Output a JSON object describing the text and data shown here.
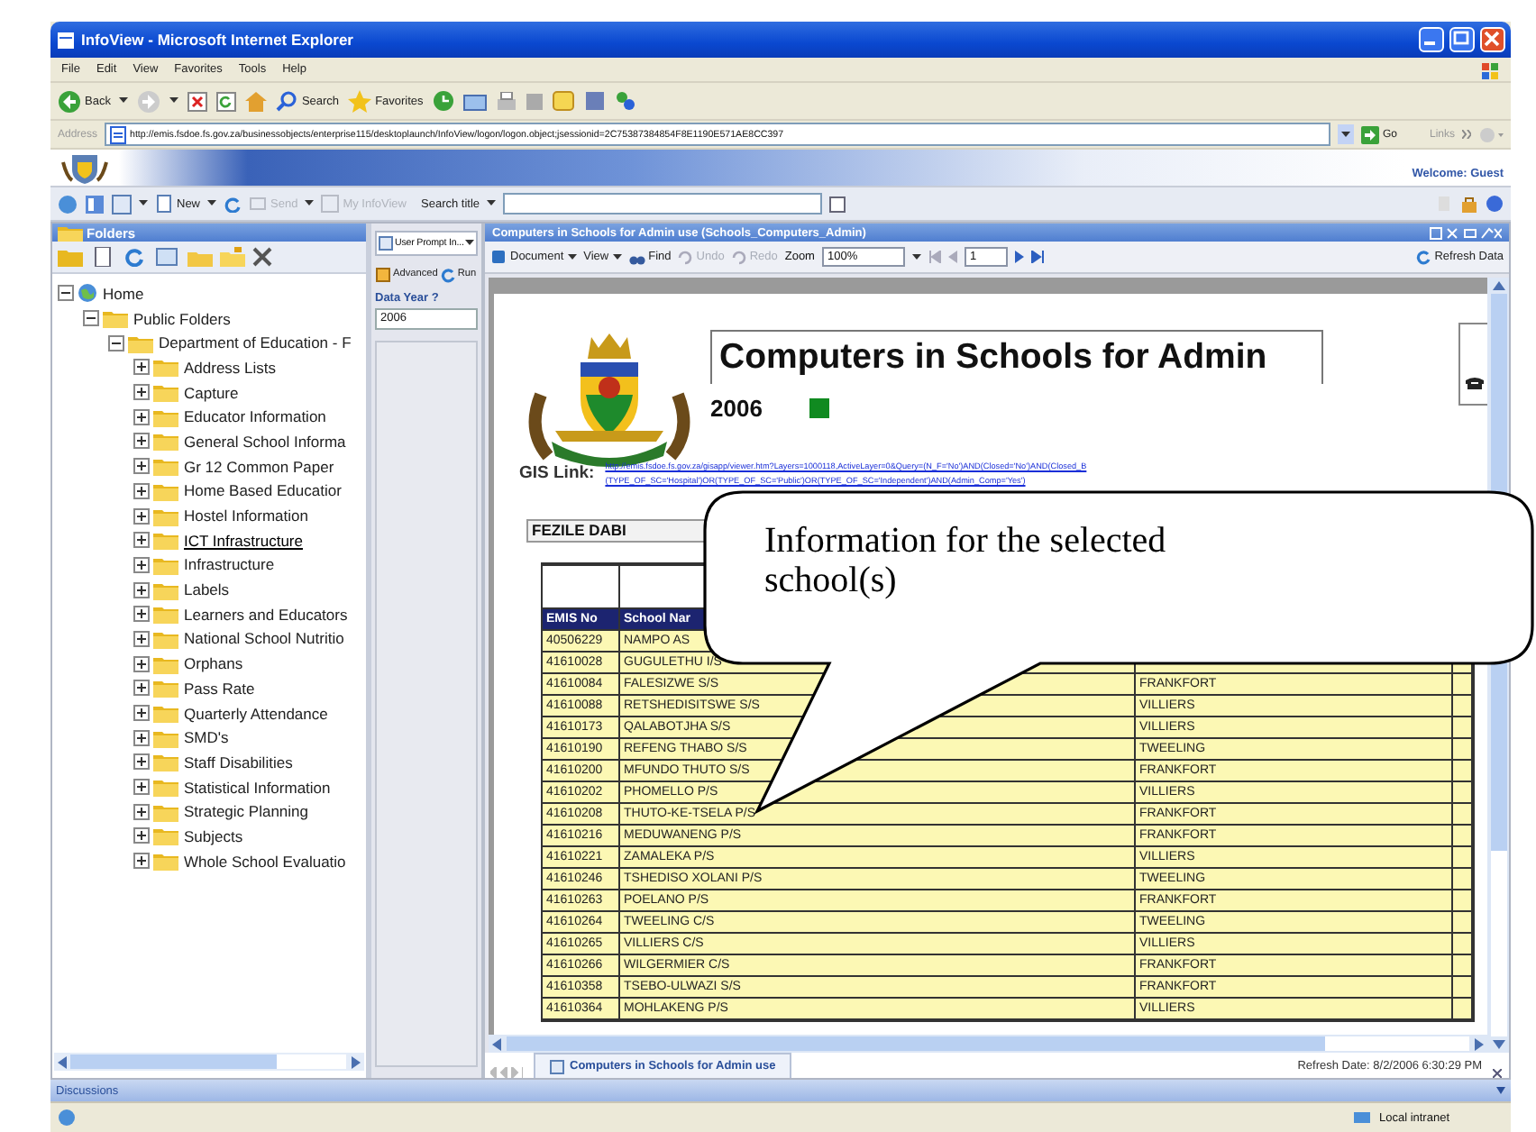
{
  "window": {
    "title": "InfoView - Microsoft Internet Explorer"
  },
  "menu": [
    "File",
    "Edit",
    "View",
    "Favorites",
    "Tools",
    "Help"
  ],
  "toolbar": [
    {
      "label": "Back",
      "kind": "back"
    },
    {
      "label": "Search",
      "kind": "search"
    },
    {
      "label": "Favorites",
      "kind": "favorites"
    }
  ],
  "address": {
    "label": "Address",
    "value": "http://emis.fsdoe.fs.gov.za/businessobjects/enterprise115/desktoplaunch/InfoView/logon/logon.object;jsessionid=2C75387384854F8E1190E571AE8CC397",
    "go": "Go",
    "links": "Links"
  },
  "infoview": {
    "welcome": "Welcome: Guest",
    "toolbar": [
      {
        "label": "New",
        "disabled": false
      },
      {
        "label": "Send",
        "disabled": true
      },
      {
        "label": "My InfoView",
        "disabled": true
      }
    ],
    "search_label": "Search title"
  },
  "folders": {
    "title": "Folders",
    "tree": [
      {
        "label": "Home",
        "expanded": true,
        "selected": false,
        "children": [
          {
            "label": "Public Folders",
            "expanded": true,
            "selected": false,
            "children": [
              {
                "label": "Department of Education - F",
                "expanded": true,
                "selected": false,
                "children": [
                  {
                    "label": "Address Lists",
                    "expanded": false,
                    "selected": false
                  },
                  {
                    "label": "Capture",
                    "expanded": false,
                    "selected": false
                  },
                  {
                    "label": "Educator Information",
                    "expanded": false,
                    "selected": false
                  },
                  {
                    "label": "General School Informa",
                    "expanded": false,
                    "selected": false
                  },
                  {
                    "label": "Gr 12 Common Paper",
                    "expanded": false,
                    "selected": false
                  },
                  {
                    "label": "Home Based Educatior",
                    "expanded": false,
                    "selected": false
                  },
                  {
                    "label": "Hostel Information",
                    "expanded": false,
                    "selected": false
                  },
                  {
                    "label": "ICT Infrastructure",
                    "expanded": false,
                    "selected": true
                  },
                  {
                    "label": "Infrastructure",
                    "expanded": false,
                    "selected": false
                  },
                  {
                    "label": "Labels",
                    "expanded": false,
                    "selected": false
                  },
                  {
                    "label": "Learners and Educators",
                    "expanded": false,
                    "selected": false
                  },
                  {
                    "label": "National School Nutritio",
                    "expanded": false,
                    "selected": false
                  },
                  {
                    "label": "Orphans",
                    "expanded": false,
                    "selected": false
                  },
                  {
                    "label": "Pass Rate",
                    "expanded": false,
                    "selected": false
                  },
                  {
                    "label": "Quarterly Attendance",
                    "expanded": false,
                    "selected": false
                  },
                  {
                    "label": "SMD's",
                    "expanded": false,
                    "selected": false
                  },
                  {
                    "label": "Staff Disabilities",
                    "expanded": false,
                    "selected": false
                  },
                  {
                    "label": "Statistical Information",
                    "expanded": false,
                    "selected": false
                  },
                  {
                    "label": "Strategic Planning",
                    "expanded": false,
                    "selected": false
                  },
                  {
                    "label": "Subjects",
                    "expanded": false,
                    "selected": false
                  },
                  {
                    "label": "Whole School Evaluatio",
                    "expanded": false,
                    "selected": false
                  }
                ]
              }
            ]
          }
        ]
      }
    ]
  },
  "prompts": {
    "tab": "User Prompt In...",
    "buttons": [
      "Advanced",
      "Run"
    ],
    "label": "Data Year ?",
    "value": "2006"
  },
  "report": {
    "title_bar": "Computers in Schools for Admin use (Schools_Computers_Admin)",
    "toolbar": [
      {
        "label": "Document",
        "kind": "menu",
        "disabled": false
      },
      {
        "label": "View",
        "kind": "menu",
        "disabled": false
      },
      {
        "label": "Find",
        "kind": "button",
        "disabled": false
      },
      {
        "label": "Undo",
        "kind": "button",
        "disabled": true
      },
      {
        "label": "Redo",
        "kind": "button",
        "disabled": true
      }
    ],
    "zoom_label": "Zoom",
    "zoom": "100%",
    "page": "1",
    "refresh": "Refresh Data",
    "heading": "Computers in Schools for Admin",
    "year": "2006",
    "gis_label": "GIS Link:",
    "gis_link": [
      "http://emis.fsdoe.fs.gov.za/gisapp/viewer.htm?Layers=1000118,ActiveLayer=0&Query=(N_F='No')AND(Closed='No')AND(Closed_B",
      "(TYPE_OF_SC='Hospital')OR(TYPE_OF_SC='Public')OR(TYPE_OF_SC='Independent')AND(Admin_Comp='Yes')"
    ],
    "district": "FEZILE DABI",
    "columns": [
      "EMIS No",
      "School Nar"
    ],
    "rows": [
      {
        "emis": "40506229",
        "school": "NAMPO AS"
      },
      {
        "emis": "41610028",
        "school": "GUGULETHU I/S"
      },
      {
        "emis": "41610084",
        "school": "FALESIZWE S/S",
        "town": "FRANKFORT"
      },
      {
        "emis": "41610088",
        "school": "RETSHEDISITSWE S/S",
        "town": "VILLIERS"
      },
      {
        "emis": "41610173",
        "school": "QALABOTJHA S/S",
        "town": "VILLIERS"
      },
      {
        "emis": "41610190",
        "school": "REFENG THABO S/S",
        "town": "TWEELING"
      },
      {
        "emis": "41610200",
        "school": "MFUNDO THUTO S/S",
        "town": "FRANKFORT"
      },
      {
        "emis": "41610202",
        "school": "PHOMELLO P/S",
        "town": "VILLIERS"
      },
      {
        "emis": "41610208",
        "school": "THUTO-KE-TSELA P/S",
        "town": "FRANKFORT"
      },
      {
        "emis": "41610216",
        "school": "MEDUWANENG P/S",
        "town": "FRANKFORT"
      },
      {
        "emis": "41610221",
        "school": "ZAMALEKA P/S",
        "town": "VILLIERS"
      },
      {
        "emis": "41610246",
        "school": "TSHEDISO XOLANI P/S",
        "town": "TWEELING"
      },
      {
        "emis": "41610263",
        "school": "POELANO P/S",
        "town": "FRANKFORT"
      },
      {
        "emis": "41610264",
        "school": "TWEELING C/S",
        "town": "TWEELING"
      },
      {
        "emis": "41610265",
        "school": "VILLIERS C/S",
        "town": "VILLIERS"
      },
      {
        "emis": "41610266",
        "school": "WILGERMIER C/S",
        "town": "FRANKFORT"
      },
      {
        "emis": "41610358",
        "school": "TSEBO-ULWAZI S/S",
        "town": "FRANKFORT"
      },
      {
        "emis": "41610364",
        "school": "MOHLAKENG P/S",
        "town": "VILLIERS"
      }
    ],
    "tab": "Computers in Schools for Admin use",
    "refresh_date": "Refresh Date: 8/2/2006 6:30:29 PM"
  },
  "callout": "Information for the selected school(s)",
  "discussions": "Discussions",
  "status": {
    "zone": "Local intranet"
  }
}
